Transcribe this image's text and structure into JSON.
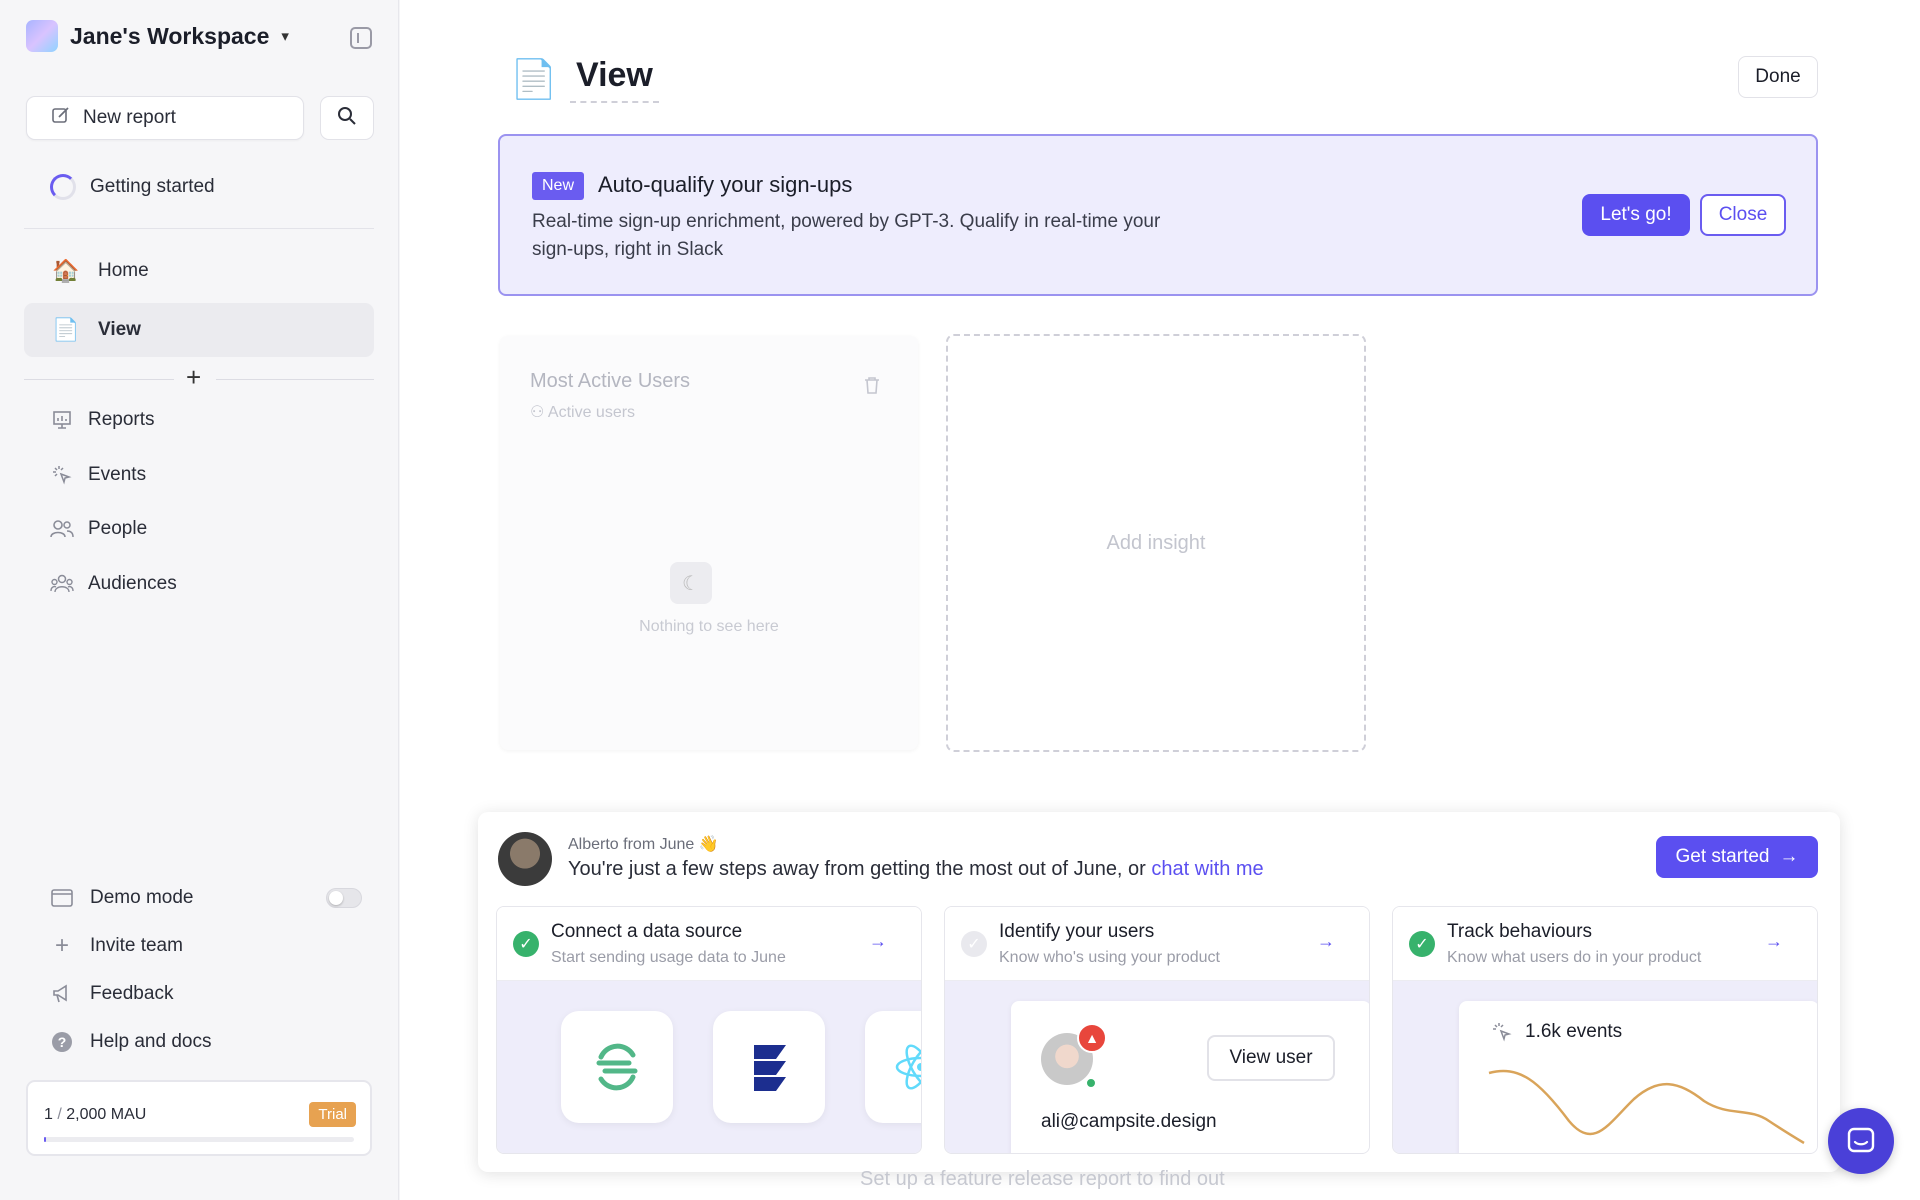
{
  "sidebar": {
    "workspace_name": "Jane's Workspace",
    "new_report_label": "New report",
    "getting_started_label": "Getting started",
    "nav": [
      {
        "label": "Home",
        "icon": "house-icon"
      },
      {
        "label": "View",
        "icon": "document-icon"
      }
    ],
    "sections": [
      {
        "label": "Reports",
        "icon": "presentation-icon"
      },
      {
        "label": "Events",
        "icon": "cursor-click-icon"
      },
      {
        "label": "People",
        "icon": "users-icon"
      },
      {
        "label": "Audiences",
        "icon": "user-group-icon"
      }
    ],
    "bottom": [
      {
        "label": "Demo mode",
        "icon": "window-icon"
      },
      {
        "label": "Invite team",
        "icon": "plus-icon"
      },
      {
        "label": "Feedback",
        "icon": "megaphone-icon"
      },
      {
        "label": "Help and docs",
        "icon": "question-icon"
      }
    ],
    "demo_mode_on": false,
    "mau": {
      "used": "1",
      "sep": " / ",
      "limit": "2,000 MAU",
      "badge": "Trial",
      "progress": 0.0005
    }
  },
  "main": {
    "title": "View",
    "done_label": "Done",
    "banner": {
      "badge": "New",
      "title": "Auto-qualify your sign-ups",
      "description": "Real-time sign-up enrichment, powered by GPT-3. Qualify in real-time your sign-ups, right in Slack",
      "primary_label": "Let's go!",
      "secondary_label": "Close"
    },
    "insight_card": {
      "title": "Most Active Users",
      "subtitle": "Active users",
      "empty_text": "Nothing to see here"
    },
    "add_insight_label": "Add insight",
    "onboarding": {
      "from": "Alberto from June 👋",
      "message": "You're just a few steps away from getting the most out of June, or ",
      "link": "chat with me",
      "cta": "Get started",
      "steps": [
        {
          "title": "Connect a data source",
          "subtitle": "Start sending usage data to June",
          "done": true
        },
        {
          "title": "Identify your users",
          "subtitle": "Know who's using your product",
          "done": false
        },
        {
          "title": "Track behaviours",
          "subtitle": "Know what users do in your product",
          "done": true
        }
      ],
      "identify_preview": {
        "button": "View user",
        "email": "ali@campsite.design"
      },
      "track_preview": {
        "label": "1.6k events"
      }
    },
    "faded_text": "Set up a feature release report to find out"
  },
  "colors": {
    "accent": "#5b4ff0",
    "success": "#37b26c",
    "trial": "#e7a251"
  }
}
